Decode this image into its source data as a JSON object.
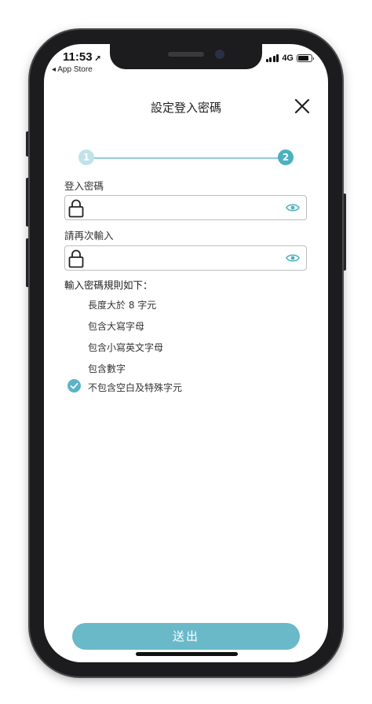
{
  "status_bar": {
    "time": "11:53",
    "location_glyph": "➚",
    "back_app": "◂ App Store",
    "network": "4G",
    "battery_level": 0.85,
    "icons": [
      "location-arrow-icon",
      "signal-icon",
      "battery-icon"
    ]
  },
  "header": {
    "title": "設定登入密碼",
    "close_icon": "close-icon"
  },
  "stepper": {
    "steps": [
      {
        "label": "1",
        "state": "inactive"
      },
      {
        "label": "2",
        "state": "active"
      }
    ],
    "current": 2
  },
  "form": {
    "password": {
      "label": "登入密碼",
      "value": "",
      "placeholder": ""
    },
    "confirm": {
      "label": "請再次輸入",
      "value": "",
      "placeholder": ""
    },
    "icons": [
      "lock-icon",
      "eye-icon"
    ]
  },
  "rules": {
    "title": "輸入密碼規則如下：",
    "items": [
      {
        "text": "長度大於 8 字元",
        "checked": false
      },
      {
        "text": "包含大寫字母",
        "checked": false
      },
      {
        "text": "包含小寫英文字母",
        "checked": false
      },
      {
        "text": "包含數字",
        "checked": false
      },
      {
        "text": "不包含空白及特殊字元",
        "checked": true
      }
    ]
  },
  "submit": {
    "label": "送出"
  },
  "colors": {
    "accent": "#4cb0bf",
    "accent_light": "#bfe3e9",
    "button": "#69b9c9",
    "check": "#5bb3c8",
    "eye": "#4fb1c1"
  }
}
